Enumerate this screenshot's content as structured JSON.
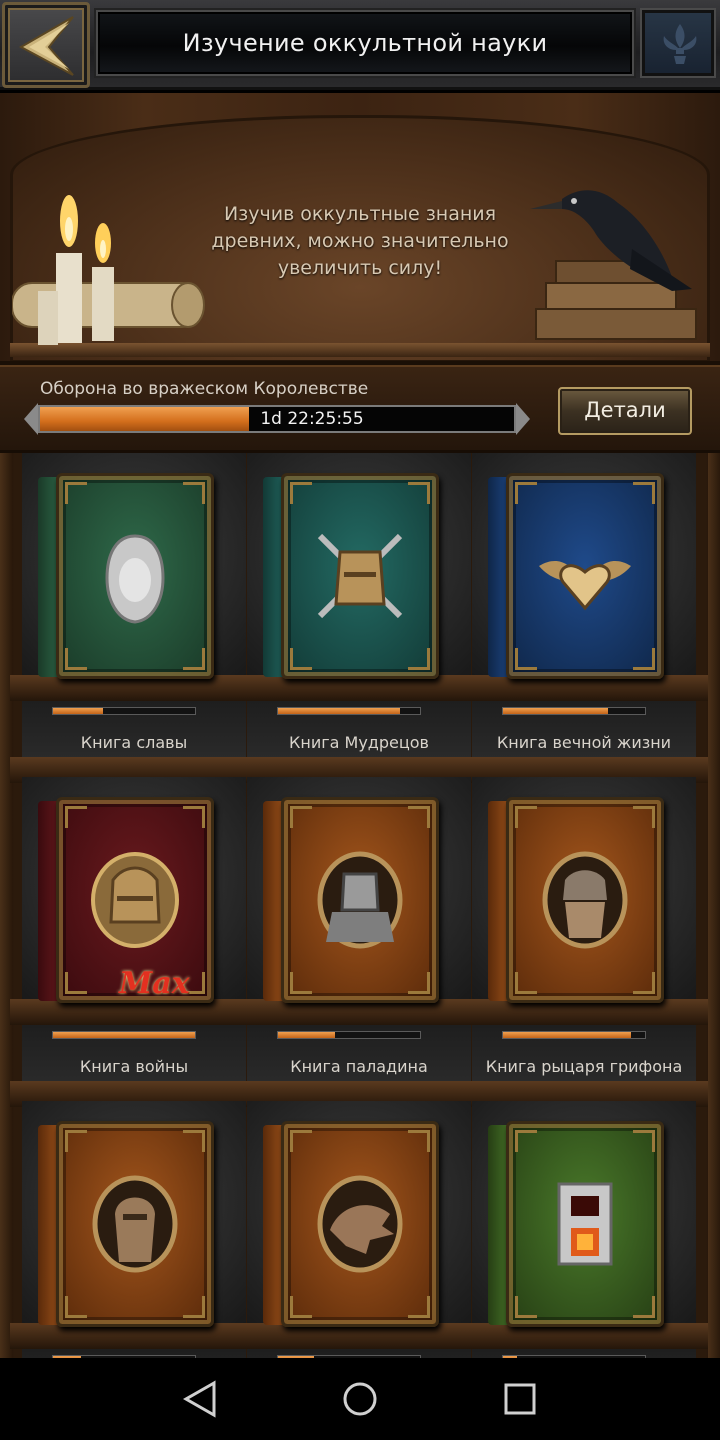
{
  "header": {
    "title": "Изучение оккультной науки"
  },
  "banner": {
    "text": "Изучив оккультные знания древних, можно значительно увеличить силу!"
  },
  "event": {
    "title": "Оборона во вражеском Королевстве",
    "timer": "1d 22:25:55",
    "progress": 0.44,
    "details_label": "Детали"
  },
  "books": [
    {
      "name": "Книга славы",
      "progress": 0.35,
      "cover": "green",
      "emblem": "veiled-statue-icon"
    },
    {
      "name": "Книга Мудрецов",
      "progress": 0.86,
      "cover": "teal",
      "emblem": "knight-helmet-swords-icon"
    },
    {
      "name": "Книга вечной жизни",
      "progress": 0.74,
      "cover": "blue",
      "emblem": "winged-heart-icon"
    },
    {
      "name": "Книга войны",
      "progress": 1.0,
      "cover": "red",
      "emblem": "knight-helmet-icon",
      "badge": "Max"
    },
    {
      "name": "Книга паладина",
      "progress": 0.4,
      "cover": "orange",
      "emblem": "armored-knight-icon"
    },
    {
      "name": "Книга рыцаря грифона",
      "progress": 0.9,
      "cover": "orange",
      "emblem": "griffon-knight-icon"
    },
    {
      "name": "",
      "progress": 0.2,
      "cover": "orange",
      "emblem": "hooded-warrior-icon"
    },
    {
      "name": "",
      "progress": 0.25,
      "cover": "orange",
      "emblem": "dragon-head-icon"
    },
    {
      "name": "",
      "progress": 0.1,
      "cover": "green-steel",
      "emblem": "tower-furnace-icon"
    }
  ],
  "colors": {
    "progress_fill": "#e08a3a",
    "cover_green": "#2f6a4a",
    "cover_teal": "#236a63",
    "cover_blue": "#1f4a8a",
    "cover_red": "#6a1a1e",
    "cover_orange": "#9a4e18",
    "cover_green_steel": "#4a7a2a"
  },
  "navbar": {
    "back": "back-triangle-icon",
    "home": "home-circle-icon",
    "recents": "recents-square-icon"
  }
}
